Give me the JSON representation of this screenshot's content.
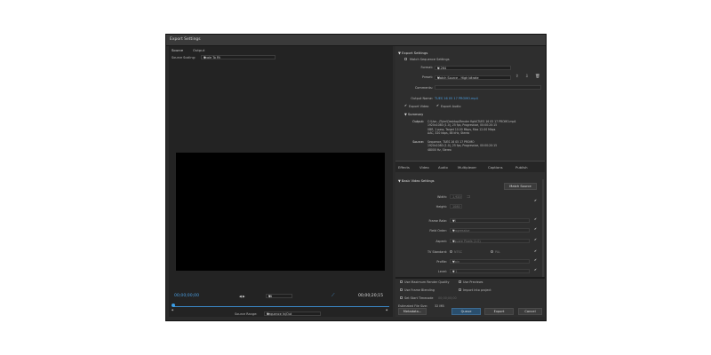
{
  "window": {
    "title": "Export Settings"
  },
  "left": {
    "tabs": [
      "Source",
      "Output"
    ],
    "scaling_label": "Source Scaling:",
    "scaling_value": "Scale To Fit",
    "timecode_in": "00;00;00;00",
    "marks": "◀ ▶",
    "fit": "Fit",
    "timecode_total": "00;00;20;15",
    "range_label": "Source Range:",
    "range_value": "Sequence In/Out"
  },
  "export_settings": {
    "header": "Export Settings",
    "match_label": "Match Sequence Settings",
    "format_label": "Format:",
    "format_value": "H.264",
    "preset_label": "Preset:",
    "preset_value": "Match Source - High bitrate",
    "comments_label": "Comments:",
    "comments_value": "",
    "output_name_label": "Output Name:",
    "output_name_value": "TUES 16 05 17 PROMO.mp4",
    "export_video": "Export Video",
    "export_audio": "Export Audio"
  },
  "summary": {
    "header": "Summary",
    "output_label": "Output:",
    "output_lines": [
      "C:\\Use...\\Tyler\\Desktop\\Render fight\\TUES 16 05 17 PROMO.mp4",
      "1920x1080 (1.0), 25 fps, Progressive, 00:00:20:15",
      "VBR, 1 pass, Target 10.00 Mbps, Max 12.00 Mbps",
      "AAC, 320 kbps, 48 kHz, Stereo"
    ],
    "source_label": "Source:",
    "source_lines": [
      "Sequence, TUES 16 05 17 PROMO",
      "1920x1080 (1.0), 25 fps, Progressive, 00:00:20:15",
      "48000 Hz, Stereo"
    ]
  },
  "tabs": [
    "Effects",
    "Video",
    "Audio",
    "Multiplexer",
    "Captions",
    "Publish"
  ],
  "video": {
    "header": "Basic Video Settings",
    "match_source": "Match Source",
    "width_label": "Width:",
    "width_value": "1,920",
    "height_label": "Height:",
    "height_value": "1080",
    "frame_rate_label": "Frame Rate:",
    "frame_rate_value": "25",
    "field_order_label": "Field Order:",
    "field_order_value": "Progressive",
    "aspect_label": "Aspect:",
    "aspect_value": "Square Pixels (1.0)",
    "tv_standard_label": "TV Standard:",
    "tv_ntsc": "NTSC",
    "tv_pal": "PAL",
    "profile_label": "Profile:",
    "profile_value": "Main",
    "level_label": "Level:",
    "level_value": "4.1"
  },
  "bottom": {
    "max_render": "Use Maximum Render Quality",
    "use_previews": "Use Previews",
    "frame_blending": "Use Frame Blending",
    "import_project": "Import into project",
    "set_start": "Set Start Timecode",
    "start_tc": "00;00;00;00",
    "file_size_label": "Estimated File Size:",
    "file_size_value": "32 MB",
    "metadata": "Metadata...",
    "queue": "Queue",
    "export": "Export",
    "cancel": "Cancel"
  },
  "colors": {
    "accent": "#4a9de0",
    "panel": "#2b2b2b"
  }
}
